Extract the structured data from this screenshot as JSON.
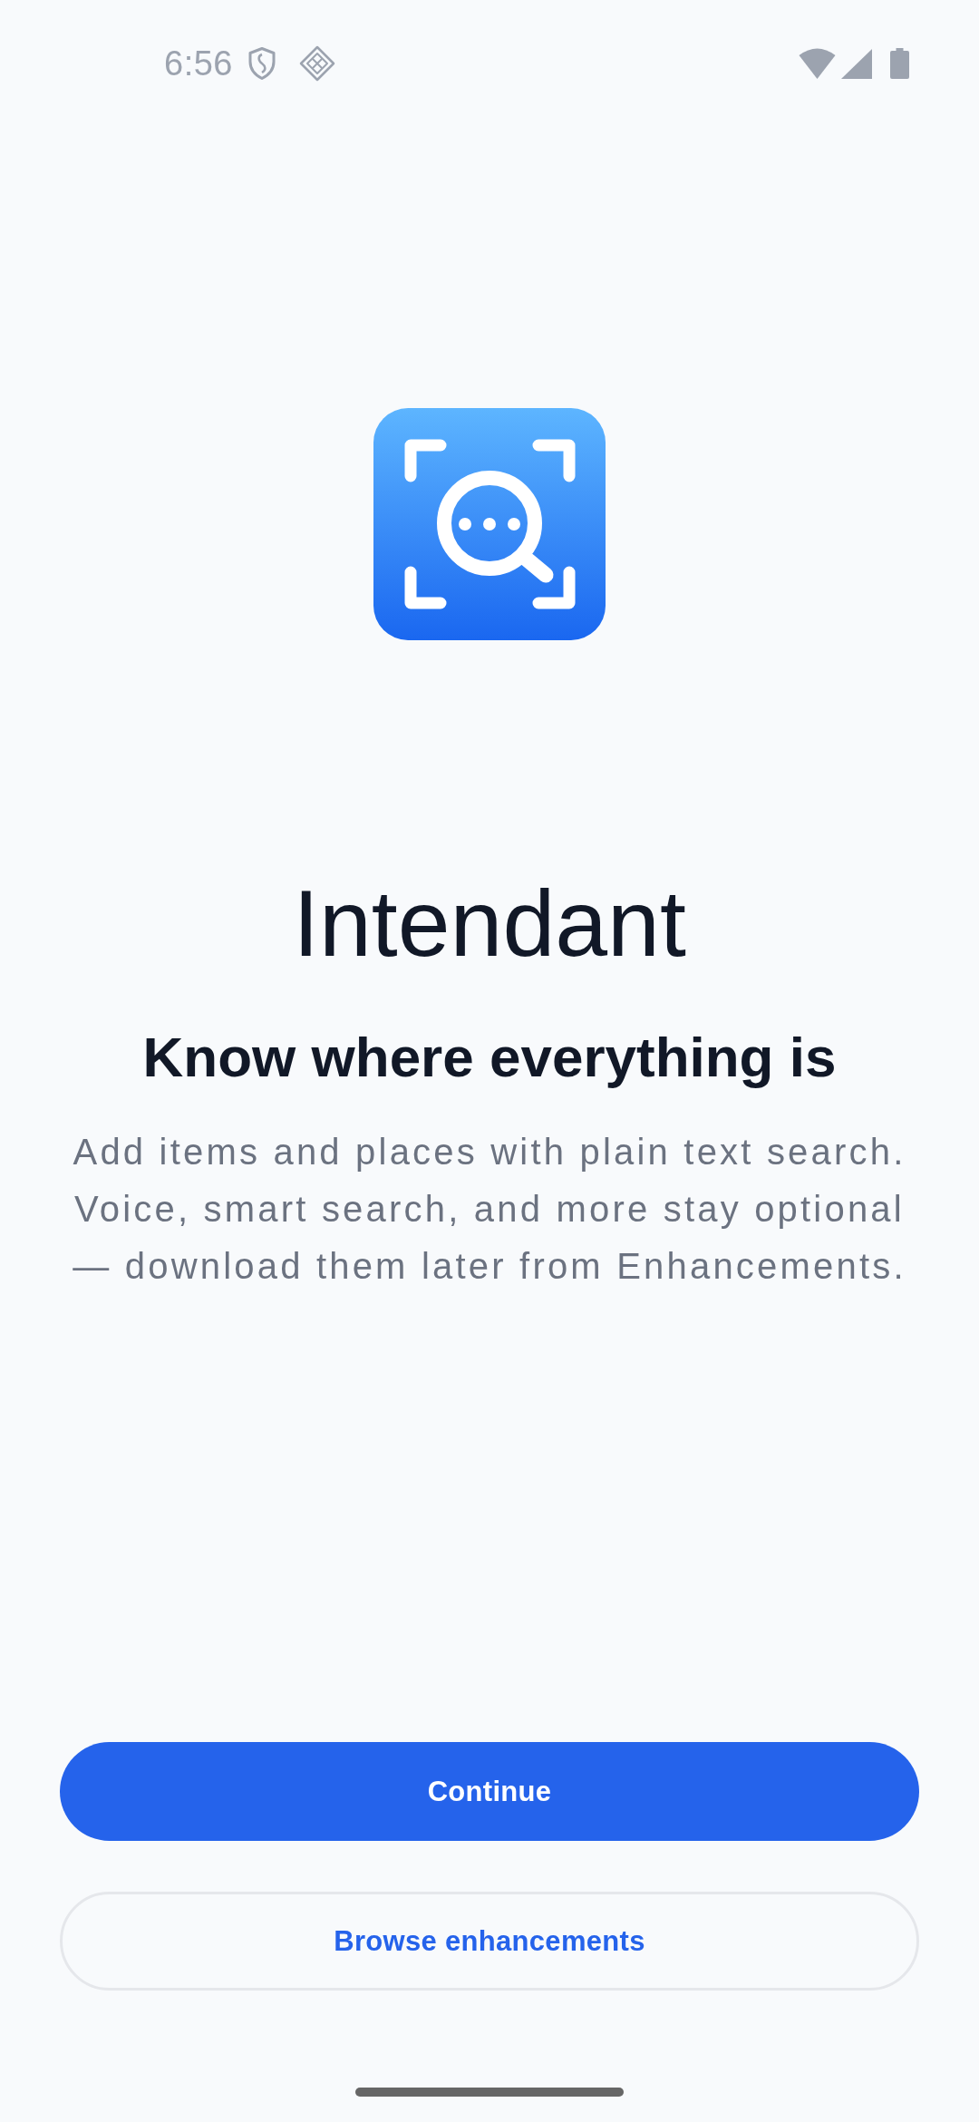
{
  "status_bar": {
    "time": "6:56"
  },
  "app": {
    "name": "Intendant",
    "tagline": "Know where everything is",
    "description": "Add items and places with plain text search. Voice, smart search, and more stay optional — download them later from Enhancements."
  },
  "buttons": [
    {
      "label": "Continue",
      "kind": "primary"
    },
    {
      "label": "Browse enhancements",
      "kind": "outline"
    }
  ]
}
